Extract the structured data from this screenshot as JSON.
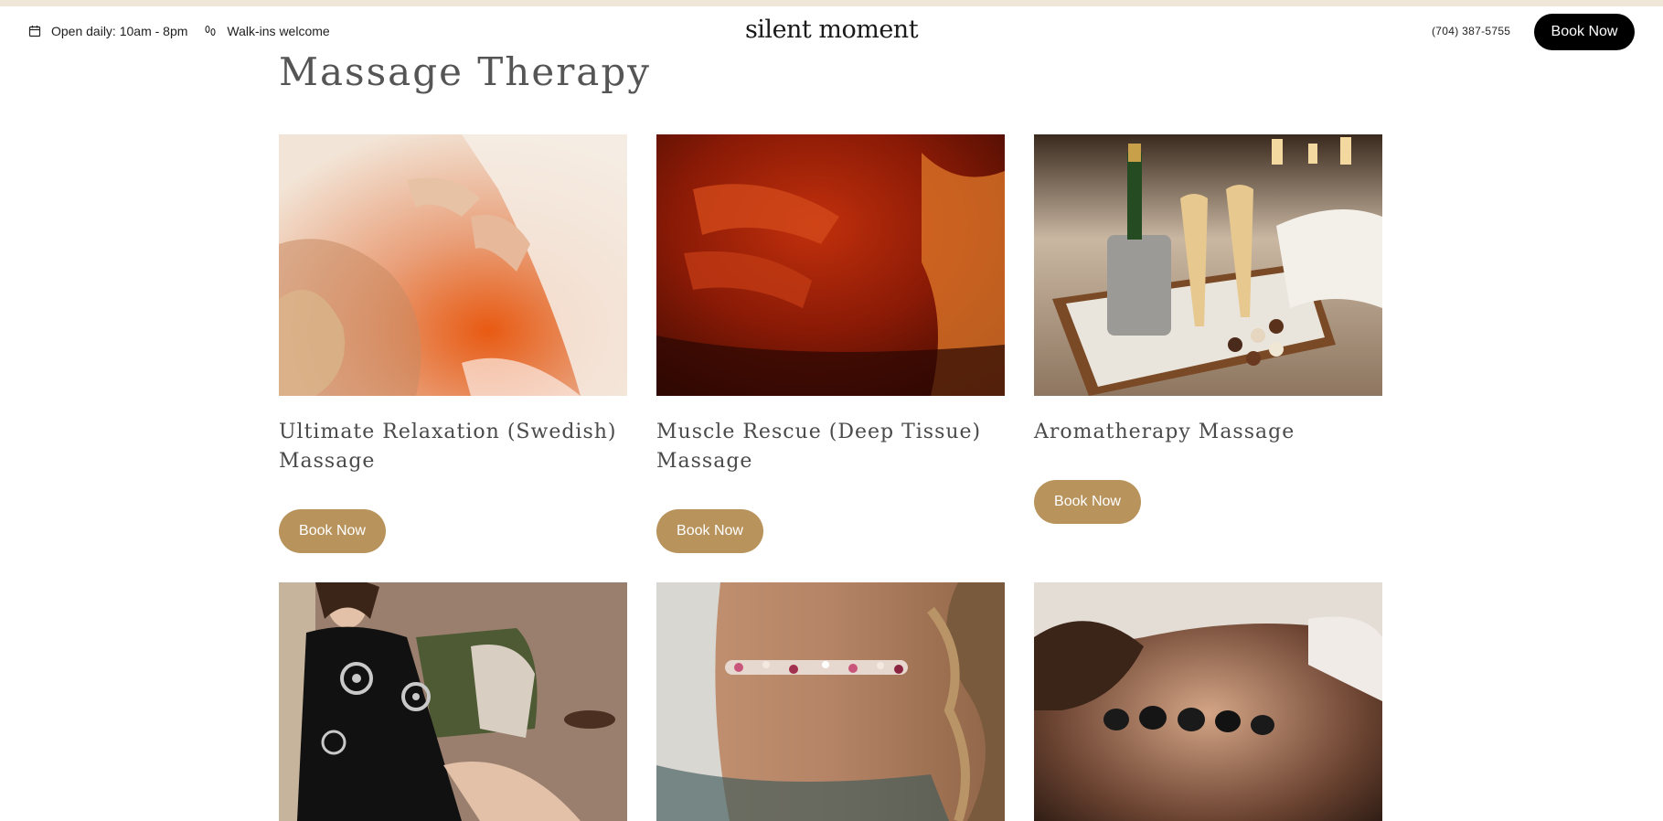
{
  "header": {
    "hours": "Open daily: 10am - 8pm",
    "walkins": "Walk-ins welcome",
    "logo": "silent moment",
    "phone": "(704) 387-5755",
    "book_label": "Book Now",
    "icons": [
      "calendar-icon",
      "footprints-icon"
    ]
  },
  "section": {
    "title": "Massage Therapy"
  },
  "cards": [
    {
      "title": "Ultimate Relaxation (Swedish) Massage",
      "button": "Book Now"
    },
    {
      "title": "Muscle Rescue (Deep Tissue) Massage",
      "button": "Book Now"
    },
    {
      "title": "Aromatherapy Massage",
      "button": "Book Now"
    },
    {
      "title": "",
      "button": ""
    },
    {
      "title": "",
      "button": ""
    },
    {
      "title": "",
      "button": ""
    }
  ],
  "colors": {
    "accent": "#b8935c",
    "header_button": "#000000",
    "top_strip": "#efe6d8",
    "heading": "#555555"
  }
}
